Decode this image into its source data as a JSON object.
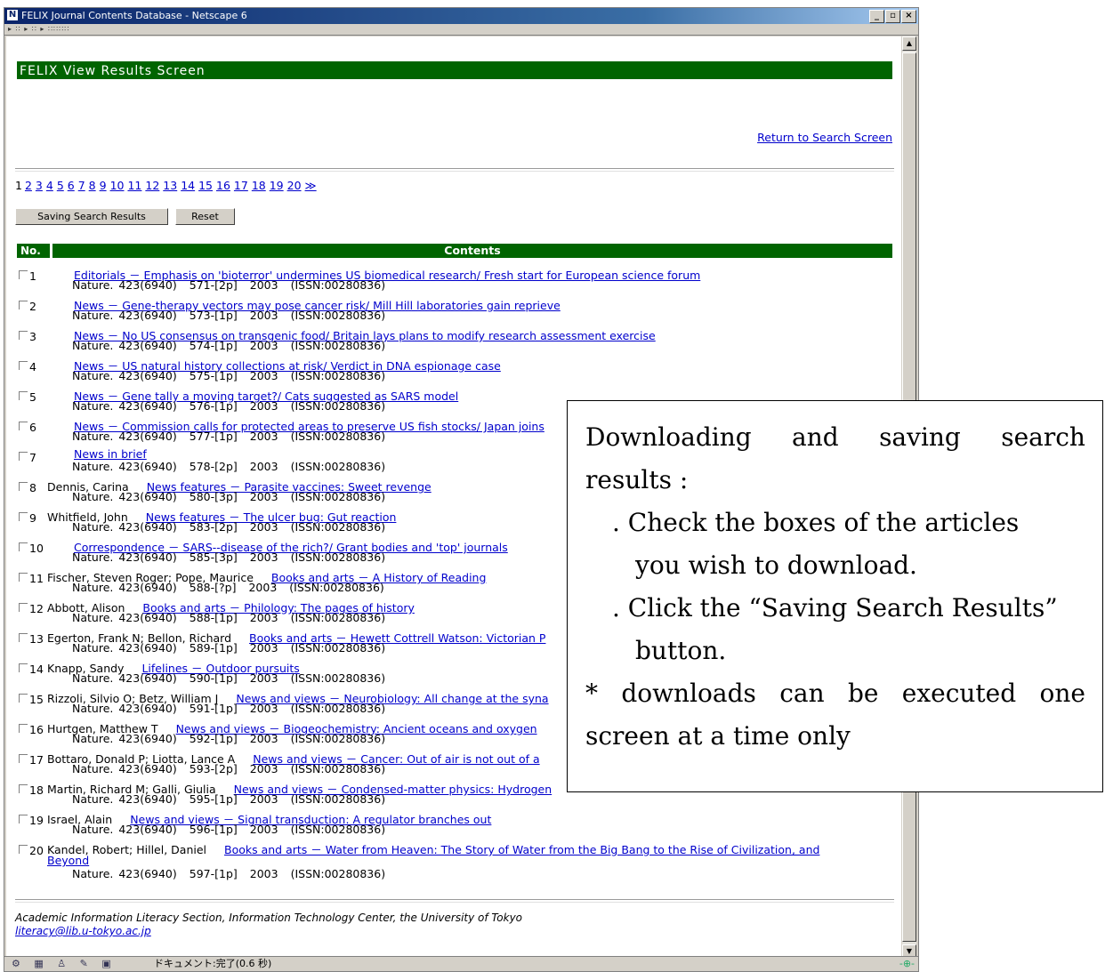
{
  "window": {
    "title": "FELIX  Journal Contents Database - Netscape 6",
    "app_icon": "N",
    "nav_strip": "▸ ∷ ▸ ∷ ▸ ∷∷∷∷",
    "minimize": "_",
    "maximize": "▫",
    "close": "×"
  },
  "page": {
    "banner": "FELIX  View Results Screen",
    "return_link": "Return to Search Screen",
    "pager": {
      "current": "1",
      "pages": [
        "2",
        "3",
        "4",
        "5",
        "6",
        "7",
        "8",
        "9",
        "10",
        "11",
        "12",
        "13",
        "14",
        "15",
        "16",
        "17",
        "18",
        "19",
        "20"
      ],
      "next": "≫"
    },
    "buttons": {
      "save": "Saving Search Results",
      "reset": "Reset"
    },
    "table_headers": {
      "no": "No.",
      "contents": "Contents"
    },
    "results": [
      {
        "no": "1",
        "author": "",
        "title": "Editorials － Emphasis on 'bioterror' undermines US biomedical research/ Fresh start for European science forum",
        "pages": "571-[2p]"
      },
      {
        "no": "2",
        "author": "",
        "title": "News － Gene-therapy vectors may pose cancer risk/ Mill Hill laboratories gain reprieve",
        "pages": "573-[1p]"
      },
      {
        "no": "3",
        "author": "",
        "title": "News － No US consensus on transgenic food/ Britain lays plans to modify research assessment exercise",
        "pages": "574-[1p]"
      },
      {
        "no": "4",
        "author": "",
        "title": "News － US natural history collections at risk/ Verdict in DNA espionage case",
        "pages": "575-[1p]"
      },
      {
        "no": "5",
        "author": "",
        "title": "News － Gene tally a moving target?/ Cats suggested as SARS model",
        "pages": "576-[1p]"
      },
      {
        "no": "6",
        "author": "",
        "title": "News － Commission calls for protected areas to preserve US fish stocks/ Japan joins",
        "pages": "577-[1p]"
      },
      {
        "no": "7",
        "author": "",
        "title": "News in brief",
        "pages": "578-[2p]"
      },
      {
        "no": "8",
        "author": "Dennis, Carina",
        "title": "News features － Parasite vaccines: Sweet revenge",
        "pages": "580-[3p]"
      },
      {
        "no": "9",
        "author": "Whitfield, John",
        "title": "News features － The ulcer bug: Gut reaction",
        "pages": "583-[2p]"
      },
      {
        "no": "10",
        "author": "",
        "title": "Correspondence － SARS--disease of the rich?/ Grant bodies and 'top' journals",
        "pages": "585-[3p]"
      },
      {
        "no": "11",
        "author": "Fischer, Steven Roger; Pope, Maurice",
        "title": "Books and arts － A History of Reading",
        "pages": "588-[?p]"
      },
      {
        "no": "12",
        "author": "Abbott, Alison",
        "title": "Books and arts － Philology: The pages of history",
        "pages": "588-[1p]"
      },
      {
        "no": "13",
        "author": "Egerton, Frank N; Bellon, Richard",
        "title": "Books and arts － Hewett Cottrell Watson: Victorian P",
        "pages": "589-[1p]"
      },
      {
        "no": "14",
        "author": "Knapp, Sandy",
        "title": "Lifelines － Outdoor pursuits",
        "pages": "590-[1p]"
      },
      {
        "no": "15",
        "author": "Rizzoli, Silvio O; Betz, William J",
        "title": "News and views － Neurobiology: All change at the syna",
        "pages": "591-[1p]"
      },
      {
        "no": "16",
        "author": "Hurtgen, Matthew T",
        "title": "News and views － Biogeochemistry: Ancient oceans and oxygen",
        "pages": "592-[1p]"
      },
      {
        "no": "17",
        "author": "Bottaro, Donald P; Liotta, Lance A",
        "title": "News and views － Cancer: Out of air is not out of a",
        "pages": "593-[2p]"
      },
      {
        "no": "18",
        "author": "Martin, Richard M; Galli, Giulia",
        "title": "News and views － Condensed-matter physics: Hydrogen",
        "pages": "595-[1p]"
      },
      {
        "no": "19",
        "author": "Israel, Alain",
        "title": "News and views － Signal transduction: A regulator branches out",
        "pages": "596-[1p]"
      },
      {
        "no": "20",
        "author": "Kandel, Robert; Hillel, Daniel",
        "title": "Books and arts － Water from Heaven: The Story of Water from the Big Bang to the Rise of Civilization, and",
        "title_cont": "Beyond",
        "pages": "597-[1p]"
      }
    ],
    "journal": "Nature. 423(6940)",
    "year": "2003",
    "issn": "(ISSN:00280836)",
    "footer": {
      "org": "Academic Information Literacy Section, Information Technology Center, the University of Tokyo",
      "email": "literacy@lib.u-tokyo.ac.jp"
    }
  },
  "status": {
    "text": "ドキュメント:完了(0.6 秒)",
    "icons": "⚙ ▦ ♙ ✎ ▣",
    "right": "-⊕-"
  },
  "callout": {
    "line1_words": [
      "Downloading",
      "and",
      "saving",
      "search"
    ],
    "line2": "results :",
    "line3": ". Check the boxes of the articles",
    "line4": "you wish to download.",
    "line5": ". Click the “Saving Search Results”",
    "line6": "button.",
    "line7_words": [
      "*",
      "downloads",
      "can",
      "be",
      "executed",
      "one"
    ],
    "line8": "screen at a time only"
  }
}
